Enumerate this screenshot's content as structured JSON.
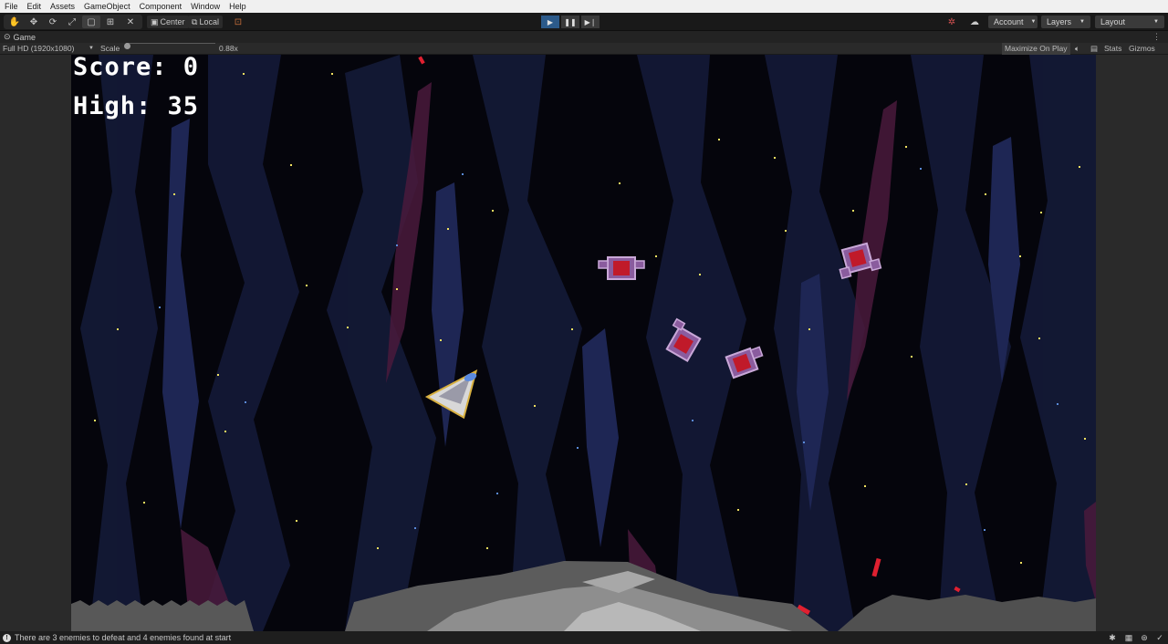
{
  "menu": [
    "File",
    "Edit",
    "Assets",
    "GameObject",
    "Component",
    "Window",
    "Help"
  ],
  "toolbar": {
    "tools": [
      "hand-tool-icon",
      "move-tool-icon",
      "rotate-tool-icon",
      "scale-tool-icon",
      "rect-tool-icon",
      "transform-tool-icon",
      "custom-tool-icon"
    ],
    "pivot_label": "Center",
    "space_label": "Local",
    "account_label": "Account",
    "layers_label": "Layers",
    "layout_label": "Layout"
  },
  "tab": {
    "title": "Game"
  },
  "game_toolbar": {
    "resolution": "Full HD (1920x1080)",
    "scale_label": "Scale",
    "scale_value": "0.88x",
    "maximize_label": "Maximize On Play",
    "stats_label": "Stats",
    "gizmos_label": "Gizmos"
  },
  "hud": {
    "score": "Score: 0",
    "high": "High: 35"
  },
  "status": {
    "message": "There are 3 enemies to defeat and 4 enemies found at start"
  },
  "colors": {
    "accent_play": "#2c5a8a",
    "space_bg": "#05050c",
    "nebula": "#141a36",
    "nebula_light": "#1e2550",
    "nebula_red": "#3a1a3a",
    "enemy": "#8a5c9e",
    "enemy_core": "#c01a2a",
    "rock_light": "#a8a8a8",
    "rock_dark": "#585858",
    "laser": "#e02030"
  }
}
